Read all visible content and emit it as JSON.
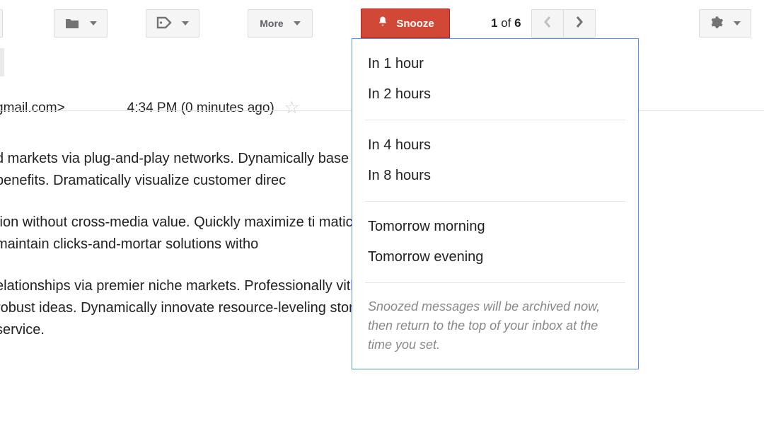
{
  "toolbar": {
    "more_label": "More",
    "snooze_label": "Snooze"
  },
  "pager": {
    "current": "1",
    "of_label": "of",
    "total": "6"
  },
  "snooze_menu": {
    "group1": [
      "In 1 hour",
      "In 2 hours"
    ],
    "group2": [
      "In 4 hours",
      "In 8 hours"
    ],
    "group3": [
      "Tomorrow morning",
      "Tomorrow evening"
    ],
    "note": "Snoozed messages will be archived now, then return to the top of your inbox at the time you set."
  },
  "message": {
    "from_suffix": "gmail.com>",
    "timestamp": "4:34 PM (0 minutes ago)",
    "body": {
      "p1": "d markets via plug-and-play networks. Dynamically base benefits. Dramatically visualize customer direc",
      "p2": "tion without cross-media value. Quickly maximize ti matically maintain clicks-and-mortar solutions witho",
      "p3": "elationships via premier niche markets. Professionally vith robust ideas. Dynamically innovate resource-leveling stomer service."
    }
  },
  "icons": {
    "folder": "folder-icon",
    "label": "label-icon",
    "bell": "bell-icon",
    "gear": "gear-icon",
    "star": "star-icon",
    "chevron_left": "chevron-left-icon",
    "chevron_right": "chevron-right-icon"
  }
}
